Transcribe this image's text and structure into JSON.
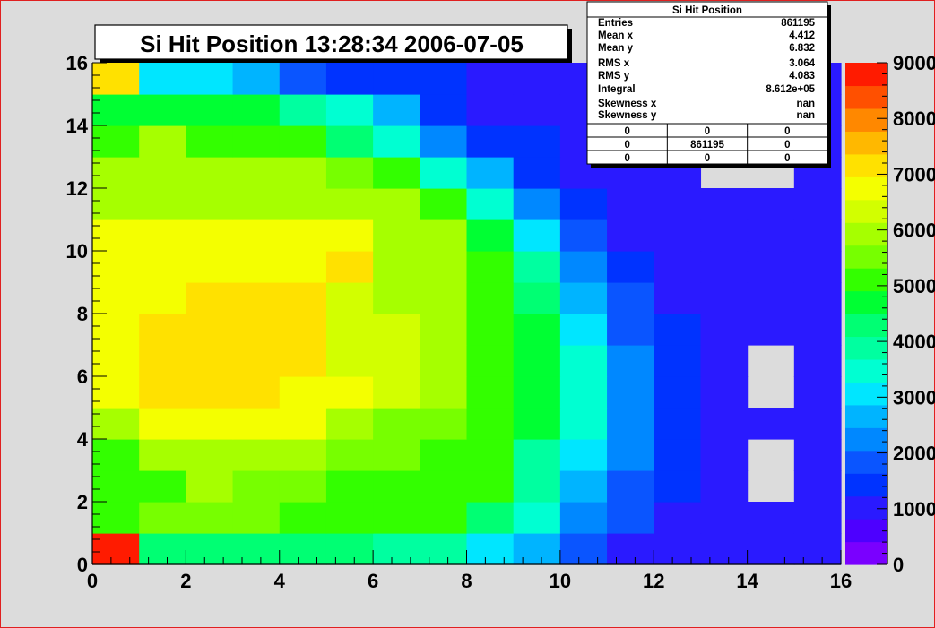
{
  "chart_data": {
    "type": "heatmap",
    "title": "Si Hit Position  13:28:34  2006-07-05",
    "xlabel": "",
    "ylabel": "",
    "xlim": [
      0,
      16
    ],
    "ylim": [
      0,
      16
    ],
    "x_ticks": [
      "0",
      "2",
      "4",
      "6",
      "8",
      "10",
      "12",
      "14",
      "16"
    ],
    "y_ticks": [
      "0",
      "2",
      "4",
      "6",
      "8",
      "10",
      "12",
      "14",
      "16"
    ],
    "zlim": [
      0,
      9000
    ],
    "z_ticks": [
      "0",
      "1000",
      "2000",
      "3000",
      "4000",
      "5000",
      "6000",
      "7000",
      "8000",
      "9000"
    ],
    "grid": false,
    "palette": [
      "#7a00ff",
      "#4d00ff",
      "#2a1aff",
      "#0033ff",
      "#0a55ff",
      "#0088ff",
      "#00b4ff",
      "#00e6ff",
      "#00ffd2",
      "#00ffa0",
      "#00ff73",
      "#00ff33",
      "#33ff00",
      "#77ff00",
      "#a6ff00",
      "#d2ff00",
      "#f4ff00",
      "#ffe100",
      "#ffb800",
      "#ff8800",
      "#ff5000",
      "#ff1b00"
    ],
    "z_rows_bottom_to_top": [
      [
        9000,
        4200,
        4200,
        4200,
        4200,
        4200,
        4000,
        4000,
        3000,
        2600,
        1800,
        1200,
        1000,
        1000,
        1000,
        1000
      ],
      [
        5000,
        5700,
        5700,
        5700,
        5100,
        5100,
        5000,
        5000,
        4400,
        3300,
        2300,
        1700,
        1000,
        1000,
        1000,
        1000
      ],
      [
        5200,
        5200,
        6000,
        5700,
        5700,
        5000,
        5000,
        5000,
        5000,
        3800,
        2700,
        2000,
        1500,
        1000,
        0,
        1000
      ],
      [
        5200,
        5800,
        5800,
        5800,
        5800,
        5700,
        5700,
        5300,
        5000,
        3900,
        3100,
        2100,
        1500,
        1000,
        0,
        1000
      ],
      [
        5800,
        6900,
        6600,
        6600,
        6600,
        6000,
        5700,
        5700,
        5000,
        4800,
        3500,
        2400,
        1500,
        1000,
        1000,
        1000
      ],
      [
        6600,
        7000,
        7000,
        7000,
        6600,
        6600,
        6300,
        5900,
        5000,
        4800,
        3500,
        2400,
        1500,
        1000,
        0,
        1000
      ],
      [
        6600,
        7000,
        7000,
        7000,
        7000,
        6500,
        6300,
        5900,
        5000,
        4800,
        3500,
        2400,
        1500,
        1000,
        0,
        1000
      ],
      [
        6600,
        7000,
        7000,
        7000,
        7000,
        6500,
        6300,
        5900,
        5000,
        4800,
        3000,
        2000,
        1500,
        1000,
        1000,
        1000
      ],
      [
        6600,
        6600,
        7000,
        7000,
        7000,
        6500,
        6000,
        5900,
        5000,
        4400,
        2700,
        2000,
        1000,
        1000,
        1000,
        1000
      ],
      [
        6600,
        6600,
        6600,
        6600,
        6600,
        7000,
        6000,
        6000,
        5000,
        3800,
        2400,
        1500,
        1000,
        1000,
        1000,
        1000
      ],
      [
        6600,
        6600,
        6600,
        6600,
        6600,
        6600,
        6000,
        6000,
        4500,
        3100,
        1700,
        1200,
        1000,
        1000,
        1000,
        1000
      ],
      [
        6000,
        6000,
        6000,
        6000,
        6000,
        6000,
        5900,
        5000,
        3600,
        2400,
        1500,
        1000,
        1000,
        1000,
        1000,
        1000
      ],
      [
        5800,
        5800,
        6000,
        5800,
        5800,
        5500,
        5100,
        3300,
        2600,
        1500,
        1000,
        1000,
        1000,
        0,
        0,
        1000
      ],
      [
        5000,
        5800,
        5000,
        5000,
        5000,
        4300,
        3500,
        2400,
        1500,
        1300,
        1000,
        1000,
        1000,
        1000,
        1000,
        1000
      ],
      [
        4600,
        4600,
        4600,
        4600,
        4000,
        3400,
        2700,
        1500,
        1200,
        1000,
        1000,
        1000,
        1000,
        1000,
        1000,
        1000
      ],
      [
        7000,
        3000,
        3000,
        2600,
        1900,
        1500,
        1300,
        1300,
        1000,
        1000,
        1000,
        1000,
        1000,
        1000,
        1000,
        1000
      ]
    ]
  },
  "stats_box": {
    "title": "Si Hit Position",
    "rows": [
      {
        "label": "Entries",
        "value": "861195"
      },
      {
        "label": "Mean x",
        "value": "4.412"
      },
      {
        "label": "Mean y",
        "value": "6.832"
      },
      {
        "label": "RMS x",
        "value": "3.064"
      },
      {
        "label": "RMS y",
        "value": "4.083"
      },
      {
        "label": "Integral",
        "value": "8.612e+05"
      },
      {
        "label": "Skewness x",
        "value": "nan"
      },
      {
        "label": "Skewness y",
        "value": "nan"
      }
    ],
    "overflow_grid": [
      [
        "0",
        "0",
        "0"
      ],
      [
        "0",
        "861195",
        "0"
      ],
      [
        "0",
        "0",
        "0"
      ]
    ]
  }
}
